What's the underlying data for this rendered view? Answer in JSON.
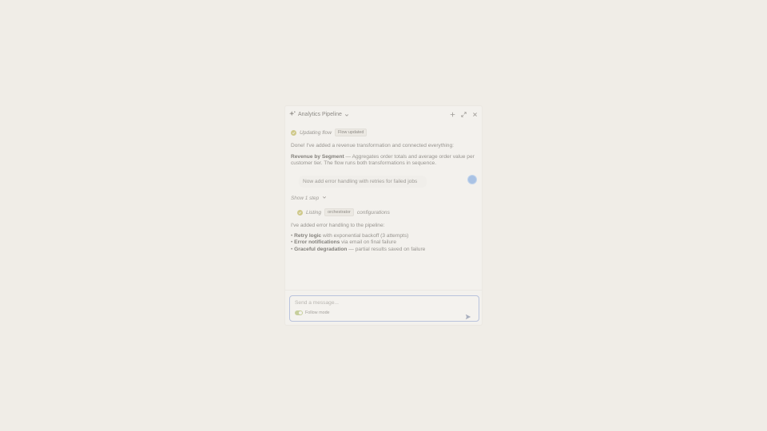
{
  "header": {
    "title": "Analytics Pipeline",
    "icons": [
      "sparkle-icon",
      "chevron-down-icon",
      "plus-icon",
      "expand-icon",
      "close-icon"
    ]
  },
  "step1": {
    "label": "Updating flow",
    "chip": "Flow updated"
  },
  "assistant1": {
    "intro": "Done! I've added a revenue transformation and connected everything:",
    "bold": "Revenue by Segment",
    "rest": " — Aggregates order totals and average order value per customer tier. The flow runs both transformations in sequence."
  },
  "user_message": "Now add error handling with retries for failed jobs",
  "show_step": {
    "label": "Show 1 step",
    "icon": "chevron-down-icon"
  },
  "step2": {
    "label": "Listing",
    "chip": "orchestrator",
    "suffix": "configurations"
  },
  "assistant2": {
    "intro": "I've added error handling to the pipeline:",
    "bullets": [
      {
        "bold": "Retry logic",
        "rest": " with exponential backoff (3 attempts)"
      },
      {
        "bold": "Error notifications",
        "rest": " via email on final failure"
      },
      {
        "bold": "Graceful degradation",
        "rest": " — partial results saved on failure"
      }
    ]
  },
  "composer": {
    "placeholder": "Send a message...",
    "follow_label": "Follow mode",
    "follow_on": true
  },
  "colors": {
    "accent": "#a9c2e4",
    "toggle_on": "#c7cf9c",
    "check": "#cfc98a",
    "input_border": "#b9c3dc"
  }
}
